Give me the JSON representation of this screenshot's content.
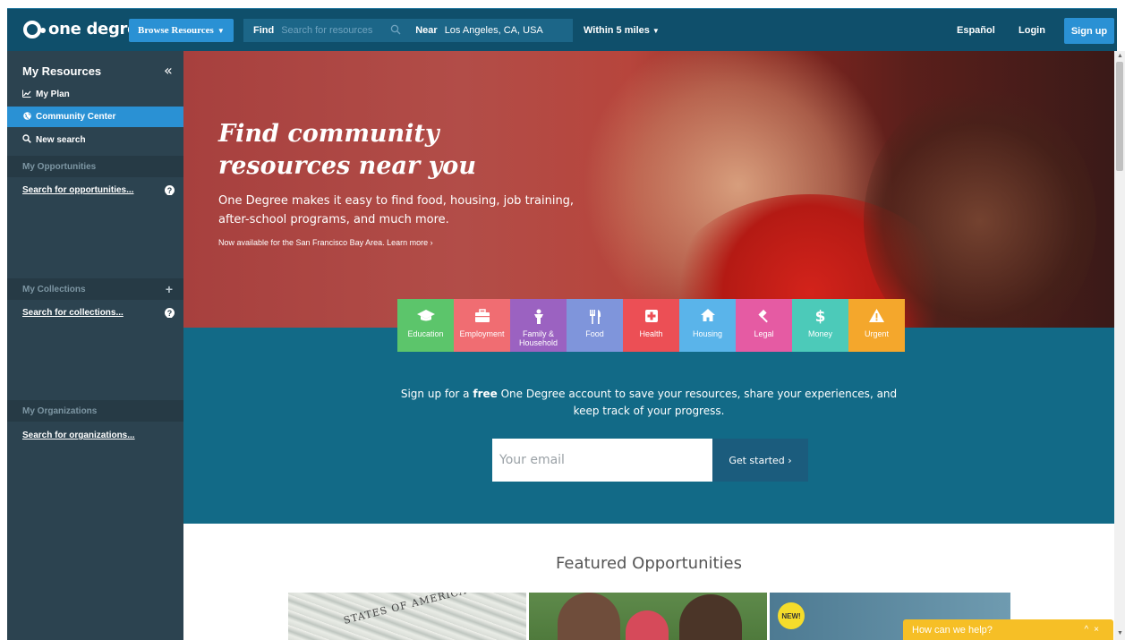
{
  "nav": {
    "logo_text": "one degree",
    "browse_label": "Browse Resources",
    "find_label": "Find",
    "find_placeholder": "Search for resources",
    "near_label": "Near",
    "near_value": "Los Angeles, CA, USA",
    "within_label": "Within 5 miles",
    "espanol_label": "Español",
    "login_label": "Login",
    "signup_label": "Sign up"
  },
  "sidebar": {
    "title": "My Resources",
    "links": [
      {
        "label": "My Plan",
        "icon": "chart-icon"
      },
      {
        "label": "Community Center",
        "icon": "globe-icon",
        "active": true
      },
      {
        "label": "New search",
        "icon": "search-icon"
      }
    ],
    "opportunities": {
      "header": "My Opportunities",
      "search": "Search for opportunities..."
    },
    "collections": {
      "header": "My Collections",
      "search": "Search for collections..."
    },
    "organizations": {
      "header": "My Organizations",
      "search": "Search for organizations..."
    }
  },
  "hero": {
    "title_line1": "Find community",
    "title_line2": "resources near you",
    "subtitle": "One Degree makes it easy to find food, housing, job training, after-school programs, and much more.",
    "note": "Now available for the San Francisco Bay Area. Learn more ›"
  },
  "categories": [
    {
      "label": "Education",
      "icon": "graduation-cap-icon",
      "color": "#5cc56b"
    },
    {
      "label": "Employment",
      "icon": "briefcase-icon",
      "color": "#f06d72"
    },
    {
      "label": "Family & Household",
      "icon": "family-icon",
      "color": "#9b62c1"
    },
    {
      "label": "Food",
      "icon": "utensils-icon",
      "color": "#7f95db"
    },
    {
      "label": "Health",
      "icon": "medical-plus-icon",
      "color": "#ec4f55"
    },
    {
      "label": "Housing",
      "icon": "home-icon",
      "color": "#5ab4ea"
    },
    {
      "label": "Legal",
      "icon": "gavel-icon",
      "color": "#e55ba3"
    },
    {
      "label": "Money",
      "icon": "dollar-icon",
      "color": "#4ccab9"
    },
    {
      "label": "Urgent",
      "icon": "warning-icon",
      "color": "#f4a72c"
    }
  ],
  "signup_band": {
    "text_before": "Sign up for a ",
    "text_bold": "free",
    "text_after": " One Degree account to save your resources, share your experiences, and",
    "text_line2": "keep track of your progress.",
    "email_placeholder": "Your email",
    "button_label": "Get started ›"
  },
  "featured": {
    "title": "Featured Opportunities",
    "badge": "NEW!"
  },
  "help_widget": {
    "label": "How can we help?"
  },
  "colors": {
    "nav_bg": "#0f4f6b",
    "accent_blue": "#2a91d4",
    "sidebar_bg": "#2c4350",
    "band_bg": "#126a87",
    "help_bg": "#f6bf26"
  }
}
